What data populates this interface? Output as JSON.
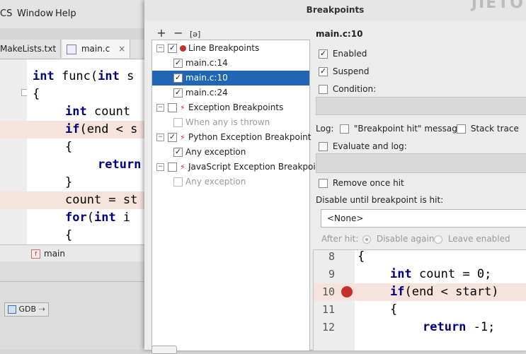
{
  "ide": {
    "menu": [
      "CS",
      "Window",
      "Help"
    ],
    "tabs": [
      "MakeLists.txt",
      "main.c"
    ],
    "tab_close": "×",
    "code_lines": [
      {
        "kw": "int",
        "rest": " func(",
        "kw2": "int",
        "rest2": " s"
      },
      {
        "text": "{"
      },
      {
        "kw": "int",
        "rest": " count"
      },
      {
        "kw": "if",
        "rest": "(end < s"
      },
      {
        "text": "{"
      },
      {
        "kw": "return",
        "rest": ""
      },
      {
        "text": "}"
      },
      {
        "text": "count = st"
      },
      {
        "kw": "for",
        "rest": "(",
        "kw2": "int",
        "rest2": " i"
      },
      {
        "text": "{"
      }
    ],
    "structure_label": "main",
    "gdb_label": "GDB"
  },
  "dialog": {
    "title": "Breakpoints",
    "watermark": "JIETO",
    "toolbar": {
      "add": "+",
      "remove": "−",
      "group": "[ǝ]"
    },
    "tree": [
      {
        "label": "Line Breakpoints",
        "level": 0,
        "expander": "−",
        "checked": true,
        "icon": "dot"
      },
      {
        "label": "main.c:14",
        "level": 1,
        "checked": true
      },
      {
        "label": "main.c:10",
        "level": 1,
        "checked": true,
        "selected": true
      },
      {
        "label": "main.c:24",
        "level": 1,
        "checked": true
      },
      {
        "label": "Exception Breakpoints",
        "level": 0,
        "expander": "−",
        "checked": false,
        "icon": "bolt"
      },
      {
        "label": "When any is thrown",
        "level": 1,
        "checked": false,
        "dim": true
      },
      {
        "label": "Python Exception Breakpoint",
        "level": 0,
        "expander": "−",
        "checked": true,
        "icon": "bolt"
      },
      {
        "label": "Any exception",
        "level": 1,
        "checked": true
      },
      {
        "label": "JavaScript Exception Breakpoints",
        "level": 0,
        "expander": "−",
        "checked": false,
        "icon": "bolt"
      },
      {
        "label": "Any exception",
        "level": 1,
        "checked": false,
        "dim": true
      }
    ],
    "details": {
      "header": "main.c:10",
      "enabled": "Enabled",
      "suspend": "Suspend",
      "condition": "Condition:",
      "log": "Log:",
      "log_message": "\"Breakpoint hit\" message",
      "stack_trace": "Stack trace",
      "evaluate": "Evaluate and log:",
      "remove_once": "Remove once hit",
      "disable_until": "Disable until breakpoint is hit:",
      "disable_until_value": "<None>",
      "after_hit": "After hit:",
      "disable_again": "Disable again",
      "leave_enabled": "Leave enabled"
    },
    "preview": [
      {
        "num": "8",
        "text": "{"
      },
      {
        "num": "9",
        "kw": "int",
        "rest": " count = 0;"
      },
      {
        "num": "10",
        "kw": "if",
        "rest": "(end < start)"
      },
      {
        "num": "11",
        "text": "{"
      },
      {
        "num": "12",
        "kw": "return",
        "rest": " -1;"
      }
    ]
  },
  "colors": {
    "breakpoint": "#c4302b",
    "selection": "#2166b4",
    "keyword": "#000080",
    "highlight_line": "#f5e3dc"
  }
}
